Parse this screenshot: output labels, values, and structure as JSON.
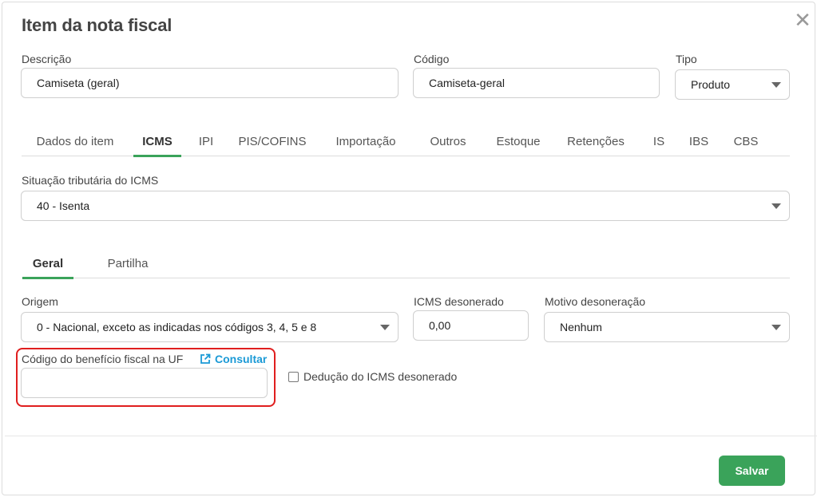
{
  "modal": {
    "title": "Item da nota fiscal",
    "close_icon": "close-icon"
  },
  "fields": {
    "descricao": {
      "label": "Descrição",
      "value": "Camiseta (geral)"
    },
    "codigo": {
      "label": "Código",
      "value": "Camiseta-geral"
    },
    "tipo": {
      "label": "Tipo",
      "value": "Produto"
    }
  },
  "tabs": [
    {
      "label": "Dados do item",
      "active": false
    },
    {
      "label": "ICMS",
      "active": true
    },
    {
      "label": "IPI",
      "active": false
    },
    {
      "label": "PIS/COFINS",
      "active": false
    },
    {
      "label": "Importação",
      "active": false
    },
    {
      "label": "Outros",
      "active": false
    },
    {
      "label": "Estoque",
      "active": false
    },
    {
      "label": "Retenções",
      "active": false
    },
    {
      "label": "IS",
      "active": false
    },
    {
      "label": "IBS",
      "active": false
    },
    {
      "label": "CBS",
      "active": false
    }
  ],
  "icms": {
    "situacao_label": "Situação tributária do ICMS",
    "situacao_value": "40 - Isenta",
    "subtabs": [
      {
        "label": "Geral",
        "active": true
      },
      {
        "label": "Partilha",
        "active": false
      }
    ],
    "origem_label": "Origem",
    "origem_value": "0 - Nacional, exceto as indicadas nos códigos 3, 4, 5 e 8",
    "desonerado_label": "ICMS desonerado",
    "desonerado_value": "0,00",
    "motivo_label": "Motivo desoneração",
    "motivo_value": "Nenhum",
    "beneficio_label": "Código do benefício fiscal na UF",
    "beneficio_value": "",
    "consultar_label": "Consultar",
    "deducao_label": "Dedução do ICMS desonerado",
    "deducao_checked": false
  },
  "footer": {
    "save_label": "Salvar"
  },
  "colors": {
    "accent": "#3aa35a",
    "link": "#1b9ad6",
    "highlight": "#e01e1e"
  }
}
